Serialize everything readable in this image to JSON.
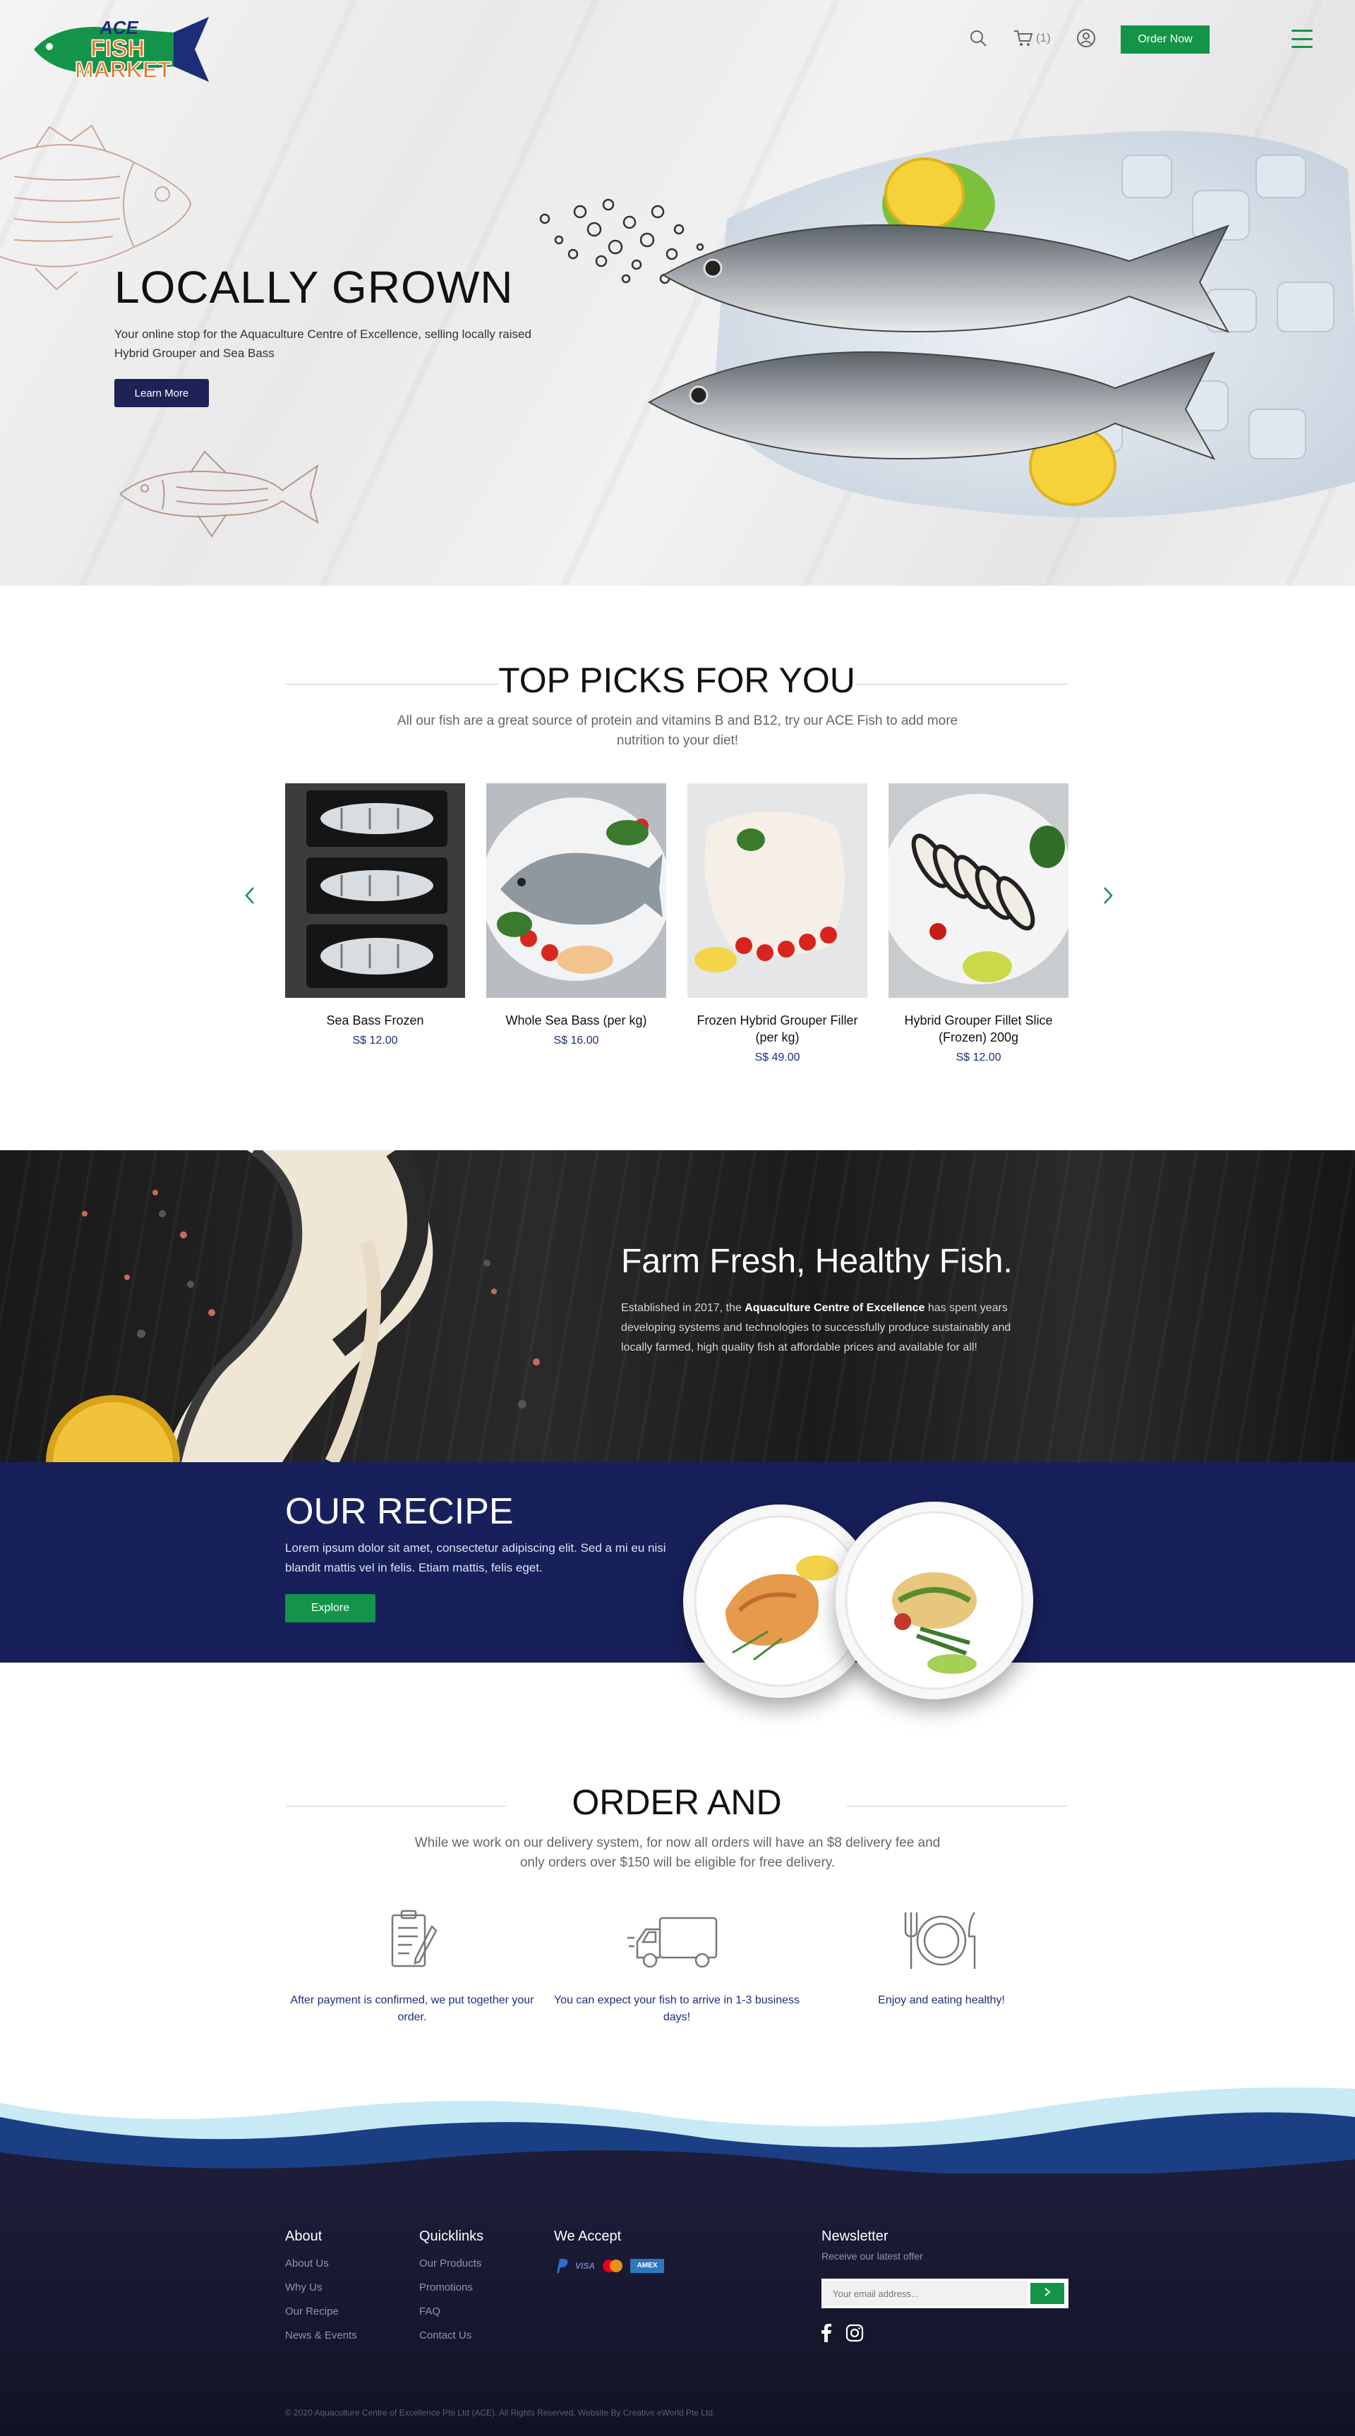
{
  "header": {
    "logo_top": "ACE",
    "logo_main_1": "FISH",
    "logo_main_2": "MARKET",
    "cart_count": "(1)",
    "order_now": "Order Now"
  },
  "hero": {
    "title": "LOCALLY GROWN",
    "subtitle": "Your online stop for the Aquaculture Centre of Excellence, selling locally raised Hybrid Grouper and Sea Bass",
    "cta": "Learn More"
  },
  "top_picks": {
    "title": "TOP PICKS FOR YOU",
    "subtitle": "All our fish are a great source of protein and vitamins B and B12, try our ACE Fish to add more nutrition to your diet!",
    "products": [
      {
        "name": "Sea Bass Frozen",
        "price": "S$ 12.00"
      },
      {
        "name": "Whole Sea Bass (per kg)",
        "price": "S$ 16.00"
      },
      {
        "name": "Frozen Hybrid Grouper Filler (per kg)",
        "price": "S$ 49.00"
      },
      {
        "name": "Hybrid Grouper Fillet Slice (Frozen) 200g",
        "price": "S$ 12.00"
      }
    ]
  },
  "farm": {
    "title": "Farm Fresh, Healthy Fish.",
    "text_before": "Established in 2017, the ",
    "text_bold": "Aquaculture Centre of Excellence",
    "text_after": " has spent years developing systems and technologies to successfully produce sustainably and locally farmed, high quality fish at affordable prices and available for all!"
  },
  "recipe": {
    "title": "OUR RECIPE",
    "text": "Lorem ipsum dolor sit amet, consectetur adipiscing elit. Sed a mi eu nisi blandit mattis vel in felis. Etiam mattis, felis eget.",
    "cta": "Explore"
  },
  "order": {
    "title": "ORDER AND",
    "subtitle": "While we work on our delivery system, for now all orders will have an $8 delivery fee and only orders over $150 will be eligible for free delivery.",
    "steps": [
      {
        "icon": "clipboard-icon",
        "text": "After payment is confirmed, we put together your order."
      },
      {
        "icon": "truck-icon",
        "text": "You can expect your fish to arrive in 1-3 business days!"
      },
      {
        "icon": "plate-cutlery-icon",
        "text": "Enjoy and eating healthy!"
      }
    ]
  },
  "footer": {
    "about": {
      "title": "About",
      "links": [
        "About Us",
        "Why Us",
        "Our Recipe",
        "News & Events"
      ]
    },
    "quicklinks": {
      "title": "Quicklinks",
      "links": [
        "Our Products",
        "Promotions",
        "FAQ",
        "Contact Us"
      ]
    },
    "accept": {
      "title": "We Accept",
      "visa": "VISA",
      "amex": "AMEX"
    },
    "newsletter": {
      "title": "Newsletter",
      "subtitle": "Receive our latest offer",
      "placeholder": "Your email address..."
    },
    "copyright": "© 2020 Aquaculture Centre of Excellence Pte Ltd (ACE). All Rights Reserved. Website By Creative eWorld Pte Ltd."
  },
  "colors": {
    "green": "#149449",
    "navy": "#1e2257",
    "recipe_bg": "#17205b",
    "footer_bg": "#1d1d3a"
  }
}
